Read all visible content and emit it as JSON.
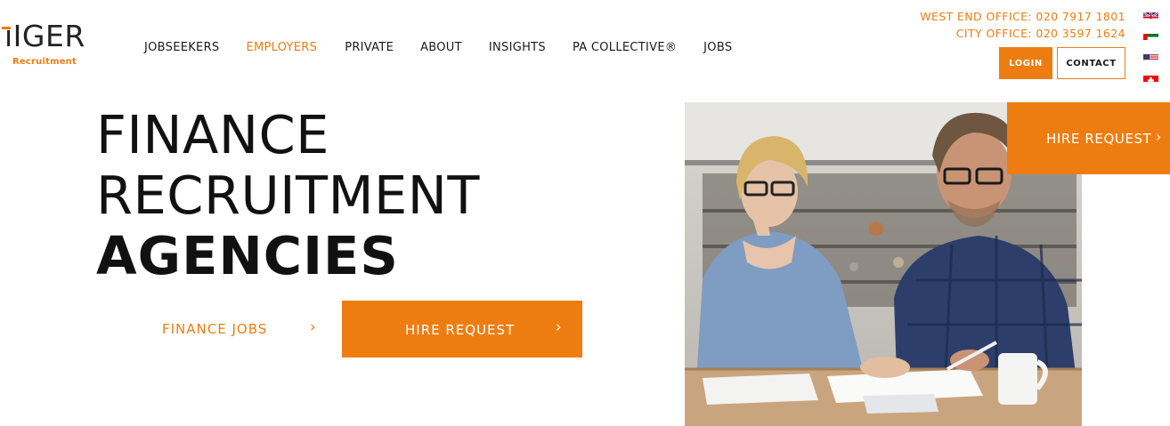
{
  "brand": {
    "logo_word": "IGER",
    "logo_sub": "Recruitment",
    "accent_color": "#ee7d11"
  },
  "nav": {
    "items": [
      {
        "label": "JOBSEEKERS",
        "active": false
      },
      {
        "label": "EMPLOYERS",
        "active": true
      },
      {
        "label": "PRIVATE",
        "active": false
      },
      {
        "label": "ABOUT",
        "active": false
      },
      {
        "label": "INSIGHTS",
        "active": false
      },
      {
        "label": "PA COLLECTIVE®",
        "active": false
      },
      {
        "label": "JOBS",
        "active": false
      }
    ]
  },
  "offices": {
    "west_end": "WEST END OFFICE: 020 7917 1801",
    "city": "CITY OFFICE: 020 3597 1624"
  },
  "header_buttons": {
    "login": "LOGIN",
    "contact": "CONTACT"
  },
  "flags": [
    "uk-flag-icon",
    "uae-flag-icon",
    "us-flag-icon",
    "swiss-flag-icon"
  ],
  "hero": {
    "line1": "FINANCE",
    "line2": "RECRUITMENT",
    "line3": "AGENCIES",
    "jobs_link": "FINANCE JOBS",
    "hire_button": "HIRE REQUEST"
  },
  "side_cta": {
    "label": "HIRE REQUEST"
  }
}
